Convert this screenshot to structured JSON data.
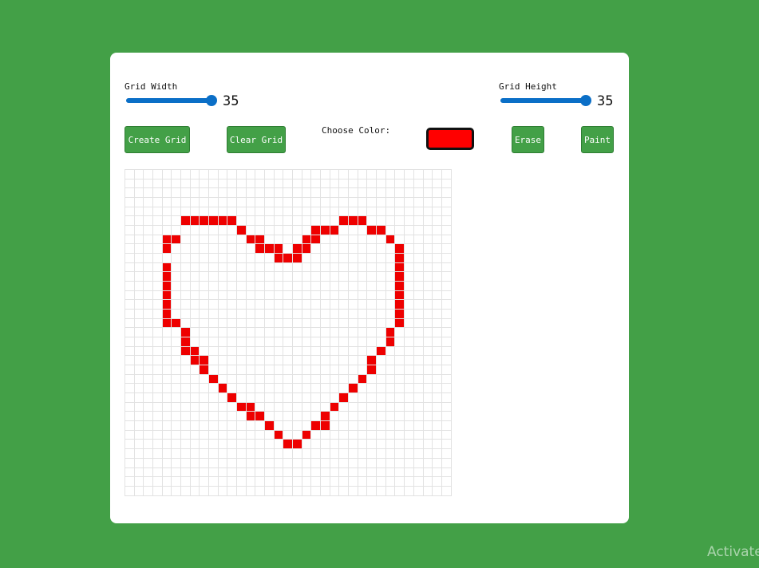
{
  "controls": {
    "grid_width_label": "Grid Width",
    "grid_width_value": "35",
    "grid_height_label": "Grid Height",
    "grid_height_value": "35",
    "create_grid_label": "Create Grid",
    "clear_grid_label": "Clear Grid",
    "choose_color_label": "Choose Color:",
    "selected_color": "#ff0000",
    "erase_label": "Erase",
    "paint_label": "Paint"
  },
  "grid": {
    "columns": 35,
    "rows": 35,
    "paint_color": "#ee0000",
    "painted_cells": [
      [
        5,
        6
      ],
      [
        5,
        7
      ],
      [
        5,
        8
      ],
      [
        5,
        9
      ],
      [
        5,
        10
      ],
      [
        5,
        11
      ],
      [
        5,
        23
      ],
      [
        5,
        24
      ],
      [
        5,
        25
      ],
      [
        6,
        12
      ],
      [
        6,
        20
      ],
      [
        6,
        21
      ],
      [
        6,
        22
      ],
      [
        6,
        26
      ],
      [
        6,
        27
      ],
      [
        7,
        4
      ],
      [
        7,
        5
      ],
      [
        7,
        13
      ],
      [
        7,
        14
      ],
      [
        7,
        19
      ],
      [
        7,
        20
      ],
      [
        7,
        28
      ],
      [
        8,
        4
      ],
      [
        8,
        14
      ],
      [
        8,
        15
      ],
      [
        8,
        16
      ],
      [
        8,
        18
      ],
      [
        8,
        19
      ],
      [
        8,
        29
      ],
      [
        9,
        16
      ],
      [
        9,
        17
      ],
      [
        9,
        18
      ],
      [
        9,
        29
      ],
      [
        10,
        4
      ],
      [
        10,
        29
      ],
      [
        11,
        4
      ],
      [
        11,
        29
      ],
      [
        12,
        4
      ],
      [
        12,
        29
      ],
      [
        13,
        4
      ],
      [
        13,
        29
      ],
      [
        14,
        4
      ],
      [
        14,
        29
      ],
      [
        15,
        4
      ],
      [
        15,
        29
      ],
      [
        16,
        4
      ],
      [
        16,
        5
      ],
      [
        17,
        6
      ],
      [
        16,
        29
      ],
      [
        17,
        28
      ],
      [
        18,
        6
      ],
      [
        18,
        28
      ],
      [
        19,
        6
      ],
      [
        19,
        7
      ],
      [
        19,
        27
      ],
      [
        20,
        7
      ],
      [
        20,
        8
      ],
      [
        20,
        26
      ],
      [
        21,
        8
      ],
      [
        21,
        26
      ],
      [
        22,
        9
      ],
      [
        22,
        25
      ],
      [
        23,
        10
      ],
      [
        23,
        24
      ],
      [
        24,
        11
      ],
      [
        24,
        23
      ],
      [
        25,
        12
      ],
      [
        25,
        13
      ],
      [
        25,
        22
      ],
      [
        26,
        13
      ],
      [
        26,
        14
      ],
      [
        26,
        21
      ],
      [
        27,
        15
      ],
      [
        27,
        20
      ],
      [
        27,
        21
      ],
      [
        28,
        16
      ],
      [
        28,
        19
      ],
      [
        29,
        17
      ],
      [
        29,
        18
      ]
    ]
  },
  "watermark": "Activate"
}
